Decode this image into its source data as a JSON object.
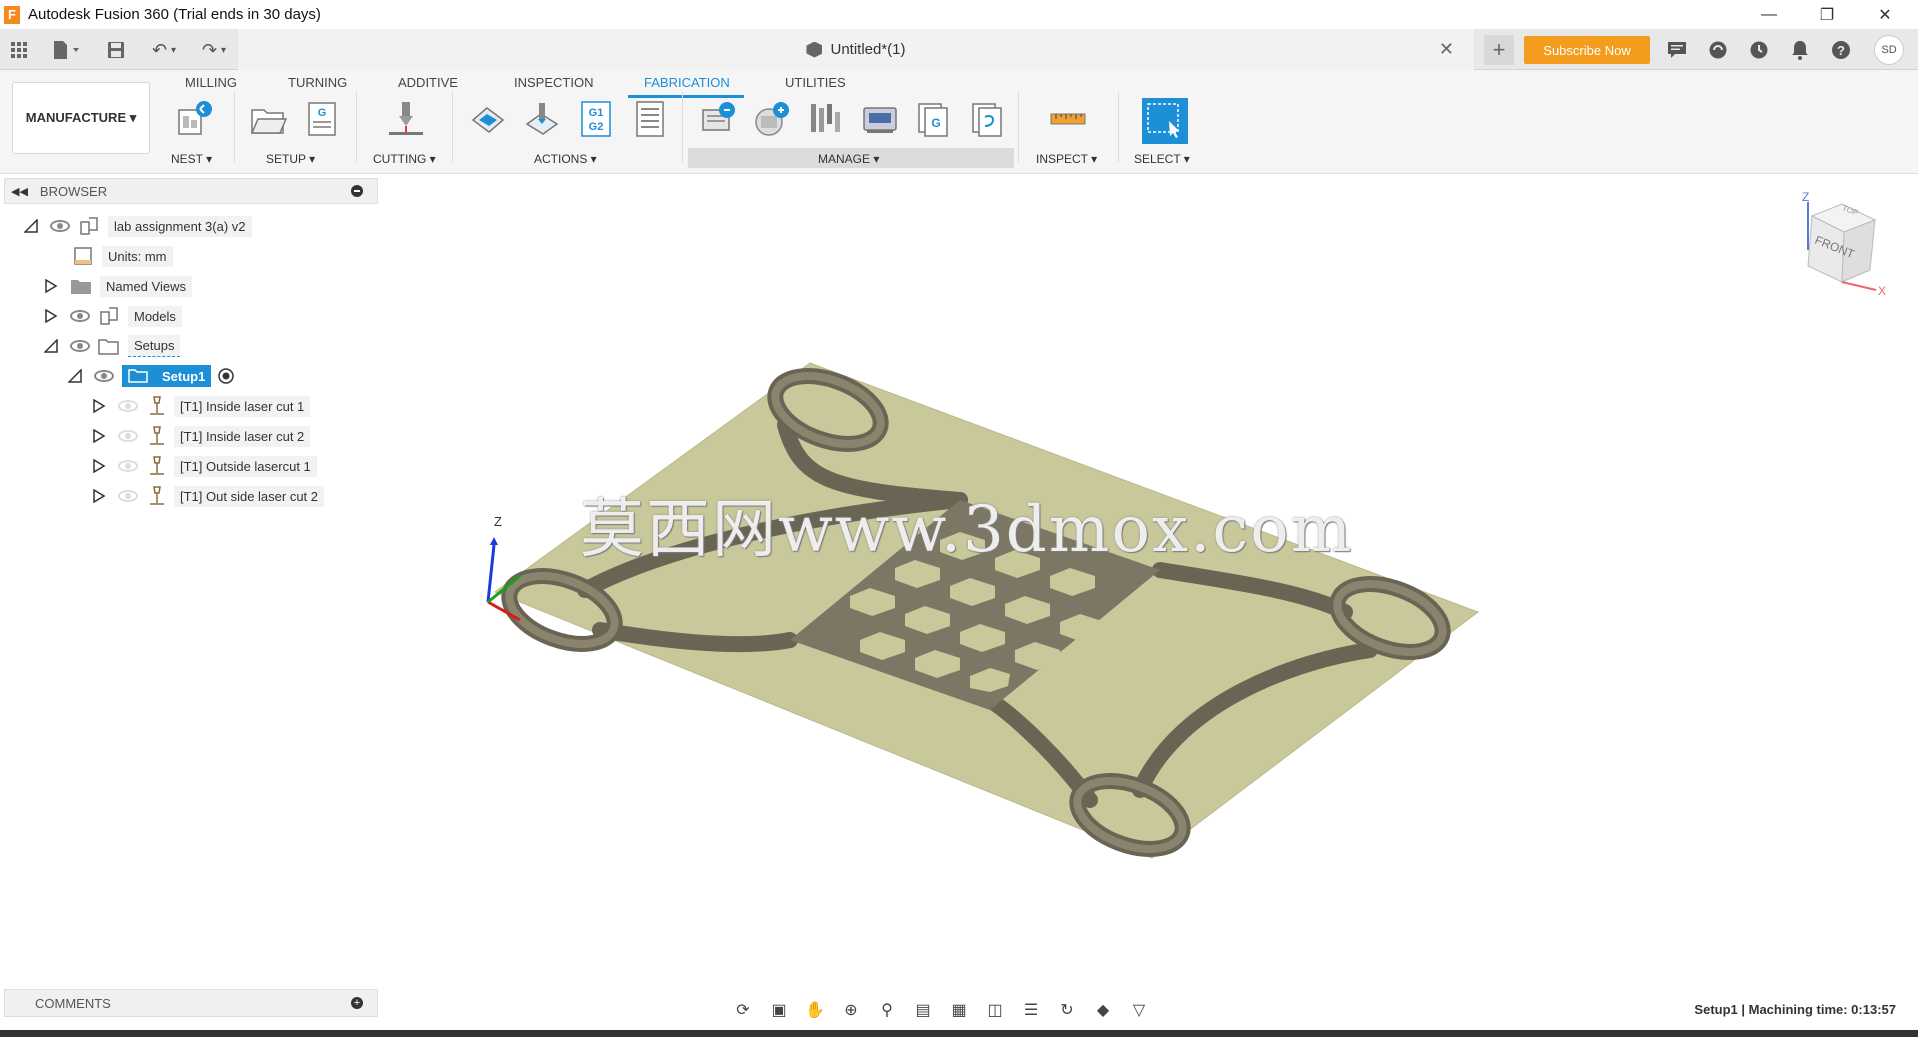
{
  "window": {
    "title": "Autodesk Fusion 360 (Trial ends in 30 days)",
    "app_icon_letter": "F"
  },
  "document": {
    "tab_title": "Untitled*(1)",
    "subscribe_label": "Subscribe Now",
    "user_initials": "SD"
  },
  "ribbon": {
    "workspace_label": "MANUFACTURE ▾",
    "tabs": [
      "MILLING",
      "TURNING",
      "ADDITIVE",
      "INSPECTION",
      "FABRICATION",
      "UTILITIES"
    ],
    "active_tab": "FABRICATION",
    "groups": {
      "nest": "NEST ▾",
      "setup": "SETUP ▾",
      "cutting": "CUTTING ▾",
      "actions": "ACTIONS ▾",
      "manage": "MANAGE ▾",
      "inspect": "INSPECT ▾",
      "select": "SELECT ▾"
    }
  },
  "browser": {
    "header": "BROWSER",
    "items": [
      {
        "label": "lab assignment 3(a) v2"
      },
      {
        "label": "Units: mm"
      },
      {
        "label": "Named Views"
      },
      {
        "label": "Models"
      },
      {
        "label": "Setups"
      },
      {
        "label": "Setup1"
      },
      {
        "label": "[T1] Inside laser cut 1"
      },
      {
        "label": "[T1] Inside laser cut 2"
      },
      {
        "label": "[T1] Outside lasercut 1"
      },
      {
        "label": "[T1] Out side laser cut 2"
      }
    ]
  },
  "comments": {
    "header": "COMMENTS"
  },
  "viewport": {
    "watermark": "莫西网www.3dmox.com",
    "axis_z": "Z",
    "viewcube_face": "FRONT",
    "viewcube_top": "TOP",
    "viewcube_z": "Z",
    "viewcube_x": "X"
  },
  "statusbar": {
    "text": "Setup1 | Machining time: 0:13:57"
  },
  "colors": {
    "accent": "#1c8fd6",
    "subscribe": "#f49c1e",
    "stock": "#c8c89a",
    "part": "#7c7664"
  }
}
